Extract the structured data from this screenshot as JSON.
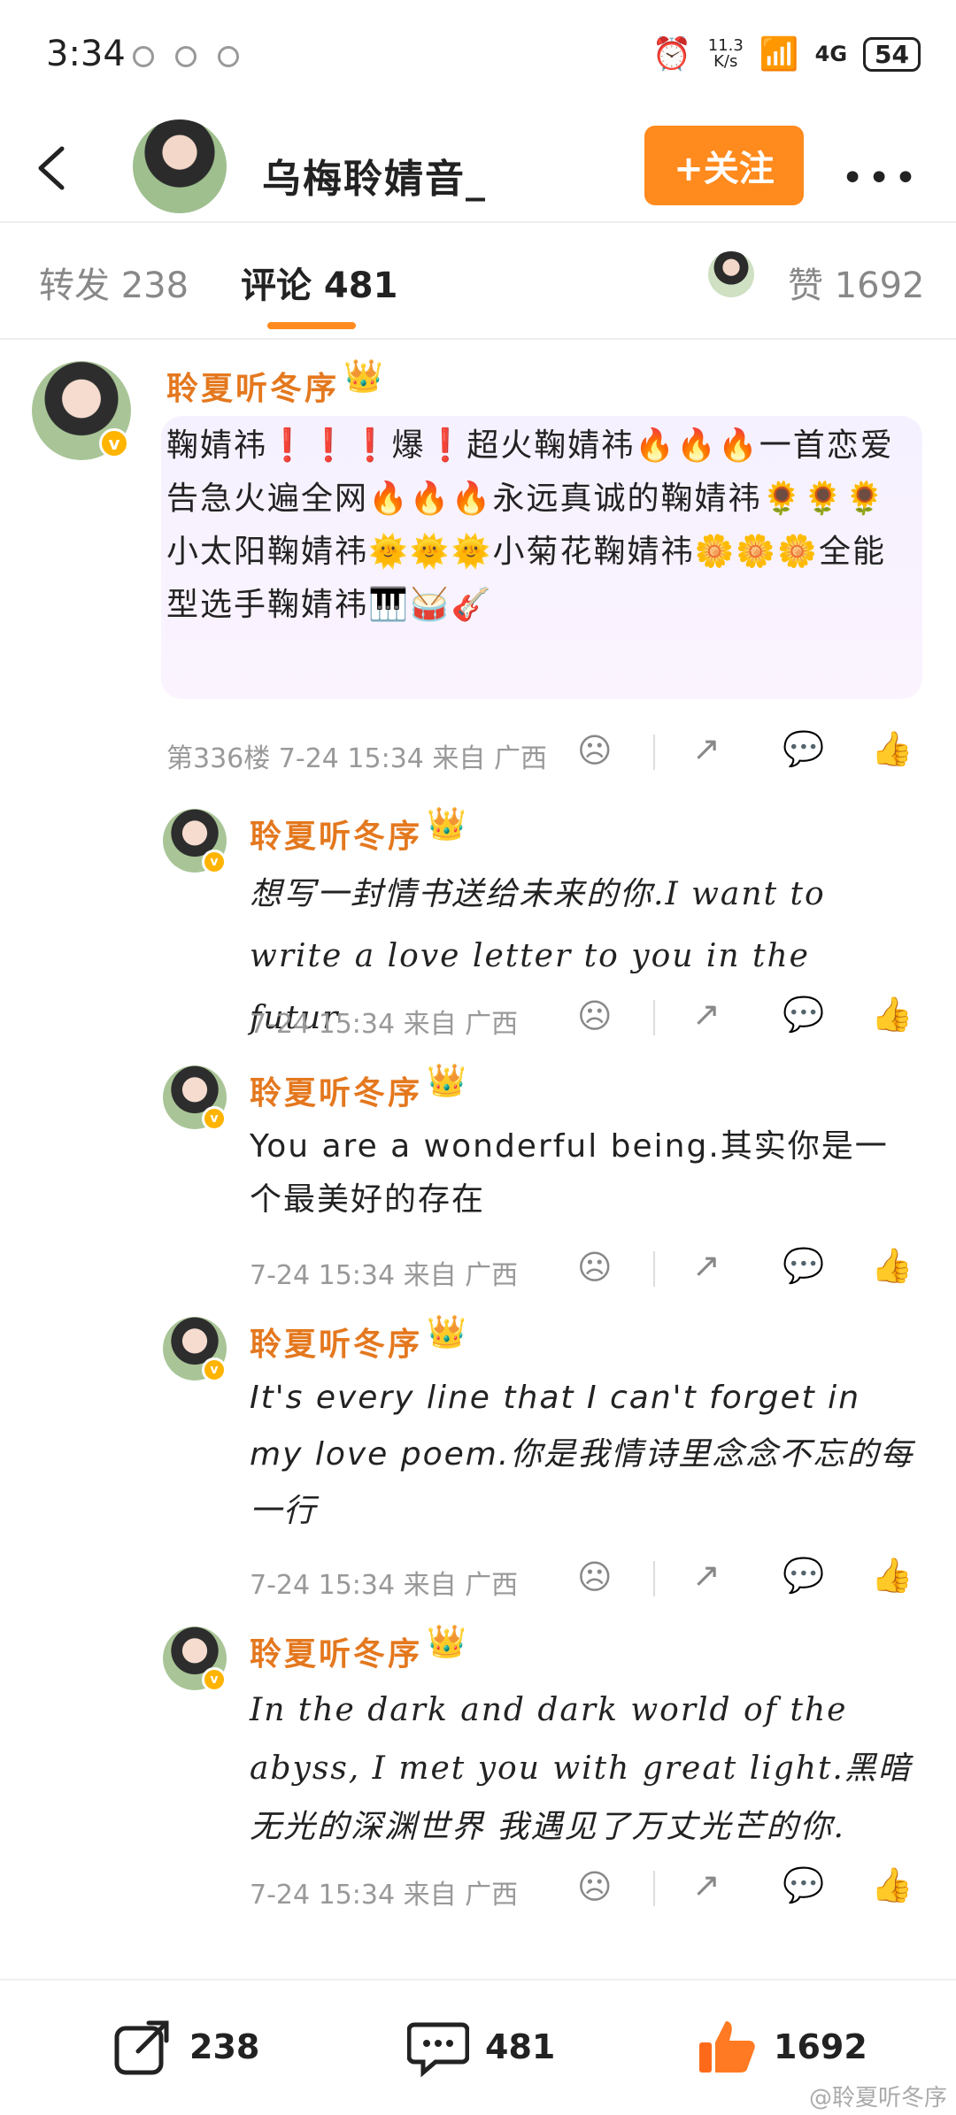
{
  "status_bar": {
    "time": "3:34",
    "net_speed": "11.3\nK/s",
    "signal": "4G",
    "battery": "54"
  },
  "header": {
    "title": "乌梅聆婧音_",
    "follow_label": "+关注"
  },
  "tabs": {
    "repost": "转发 238",
    "comments": "评论 481",
    "likes": "赞 1692"
  },
  "main_comment": {
    "user": "聆夏听冬序",
    "text": "鞠婧祎❗❗❗爆❗超火鞠婧祎🔥🔥🔥一首恋爱告急火遍全网🔥🔥🔥永远真诚的鞠婧祎🌻🌻🌻小太阳鞠婧祎🌞🌞🌞小菊花鞠婧祎🌼🌼🌼全能型选手鞠婧祎🎹🥁🎸",
    "meta": "第336楼  7-24 15:34  来自 广西"
  },
  "replies": [
    {
      "user": "聆夏听冬序",
      "text": "想写一封情书送给未来的你.I want to write a love letter to you in the futur",
      "meta": "7-24 15:34  来自 广西"
    },
    {
      "user": "聆夏听冬序",
      "text": "You are a wonderful being.其实你是一个最美好的存在",
      "meta": "7-24 15:34  来自 广西"
    },
    {
      "user": "聆夏听冬序",
      "text": "It's every line that I can't forget in my love poem.你是我情诗里念念不忘的每一行",
      "meta": "7-24 15:34  来自 广西"
    },
    {
      "user": "聆夏听冬序",
      "text": "In the dark and dark world of the abyss, I met you with great light.黑暗无光的深渊世界 我遇见了万丈光芒的你.",
      "meta": "7-24 15:34  来自 广西"
    }
  ],
  "bottom_bar": {
    "repost_count": "238",
    "comment_count": "481",
    "like_count": "1692"
  },
  "watermark": "@聆夏听冬序",
  "colors": {
    "accent": "#ff8a1d",
    "username": "#e4781e"
  }
}
